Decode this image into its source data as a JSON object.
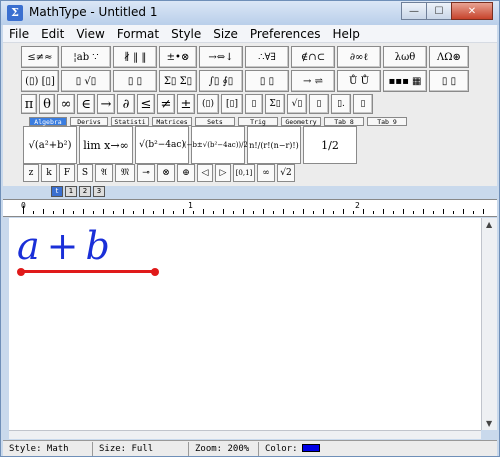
{
  "window": {
    "title": "MathType - Untitled 1",
    "app_icon_glyph": "Σ"
  },
  "window_buttons": {
    "minimize": "—",
    "maximize": "☐",
    "close": "✕"
  },
  "menu": {
    "items": [
      "File",
      "Edit",
      "View",
      "Format",
      "Style",
      "Size",
      "Preferences",
      "Help"
    ]
  },
  "symbol_palettes_row1": [
    "≤≠≈",
    "¦ab ∵",
    "∦ ‖ ‖",
    "±•⊗",
    "→⇔↓",
    "∴∀∃",
    "∉∩⊂",
    "∂∞ℓ",
    "λωθ",
    "ΛΩ⊛"
  ],
  "symbol_palettes_row2": [
    "(▯) [▯]",
    "▯ √▯",
    "▯ ▯",
    "Σ▯ Σ▯",
    "∫▯ ∮▯",
    "▯ ▯",
    "→ ⇌",
    "Ů Ů",
    "▪▪▪ ▦",
    "▯ ▯"
  ],
  "symbol_row3": [
    "π",
    "θ",
    "∞",
    "∈",
    "→",
    "∂",
    "≤",
    "≠",
    "±",
    "(▯)",
    "[▯]",
    "▯",
    "Σ▯",
    "√▯",
    "▯",
    "▯.",
    "▯"
  ],
  "tabs": [
    "Algebra",
    "Derivs",
    "Statisti",
    "Matrices",
    "Sets",
    "Trig",
    "Geometry",
    "Tab 8",
    "Tab 9"
  ],
  "active_tab": "Algebra",
  "templates": [
    "√(a²+b²)",
    "lim x→∞",
    "√(b²−4ac)",
    "(−b±√(b²−4ac))/2a",
    "n!/(r!(n−r)!)",
    "1/2"
  ],
  "small_row": [
    "z",
    "k",
    "F",
    "S",
    "𝔄",
    "𝔐",
    "⊸",
    "⊗",
    "⊕",
    "◁",
    "▷",
    "[0,1]",
    "∞",
    "√2"
  ],
  "level_buttons": [
    "t",
    "1",
    "2",
    "3"
  ],
  "ruler": {
    "marks": [
      "0",
      "1",
      "2"
    ]
  },
  "equation": {
    "left": "a",
    "op": "+",
    "right": "b"
  },
  "status": {
    "style": "Style: Math",
    "size": "Size: Full",
    "zoom": "Zoom: 200%",
    "color_label": "Color:",
    "color_value": "#0000e6"
  },
  "colors": {
    "equation": "#1a2fd8",
    "annotation_line": "#e01a1a",
    "active_tab": "#3a7de0"
  }
}
